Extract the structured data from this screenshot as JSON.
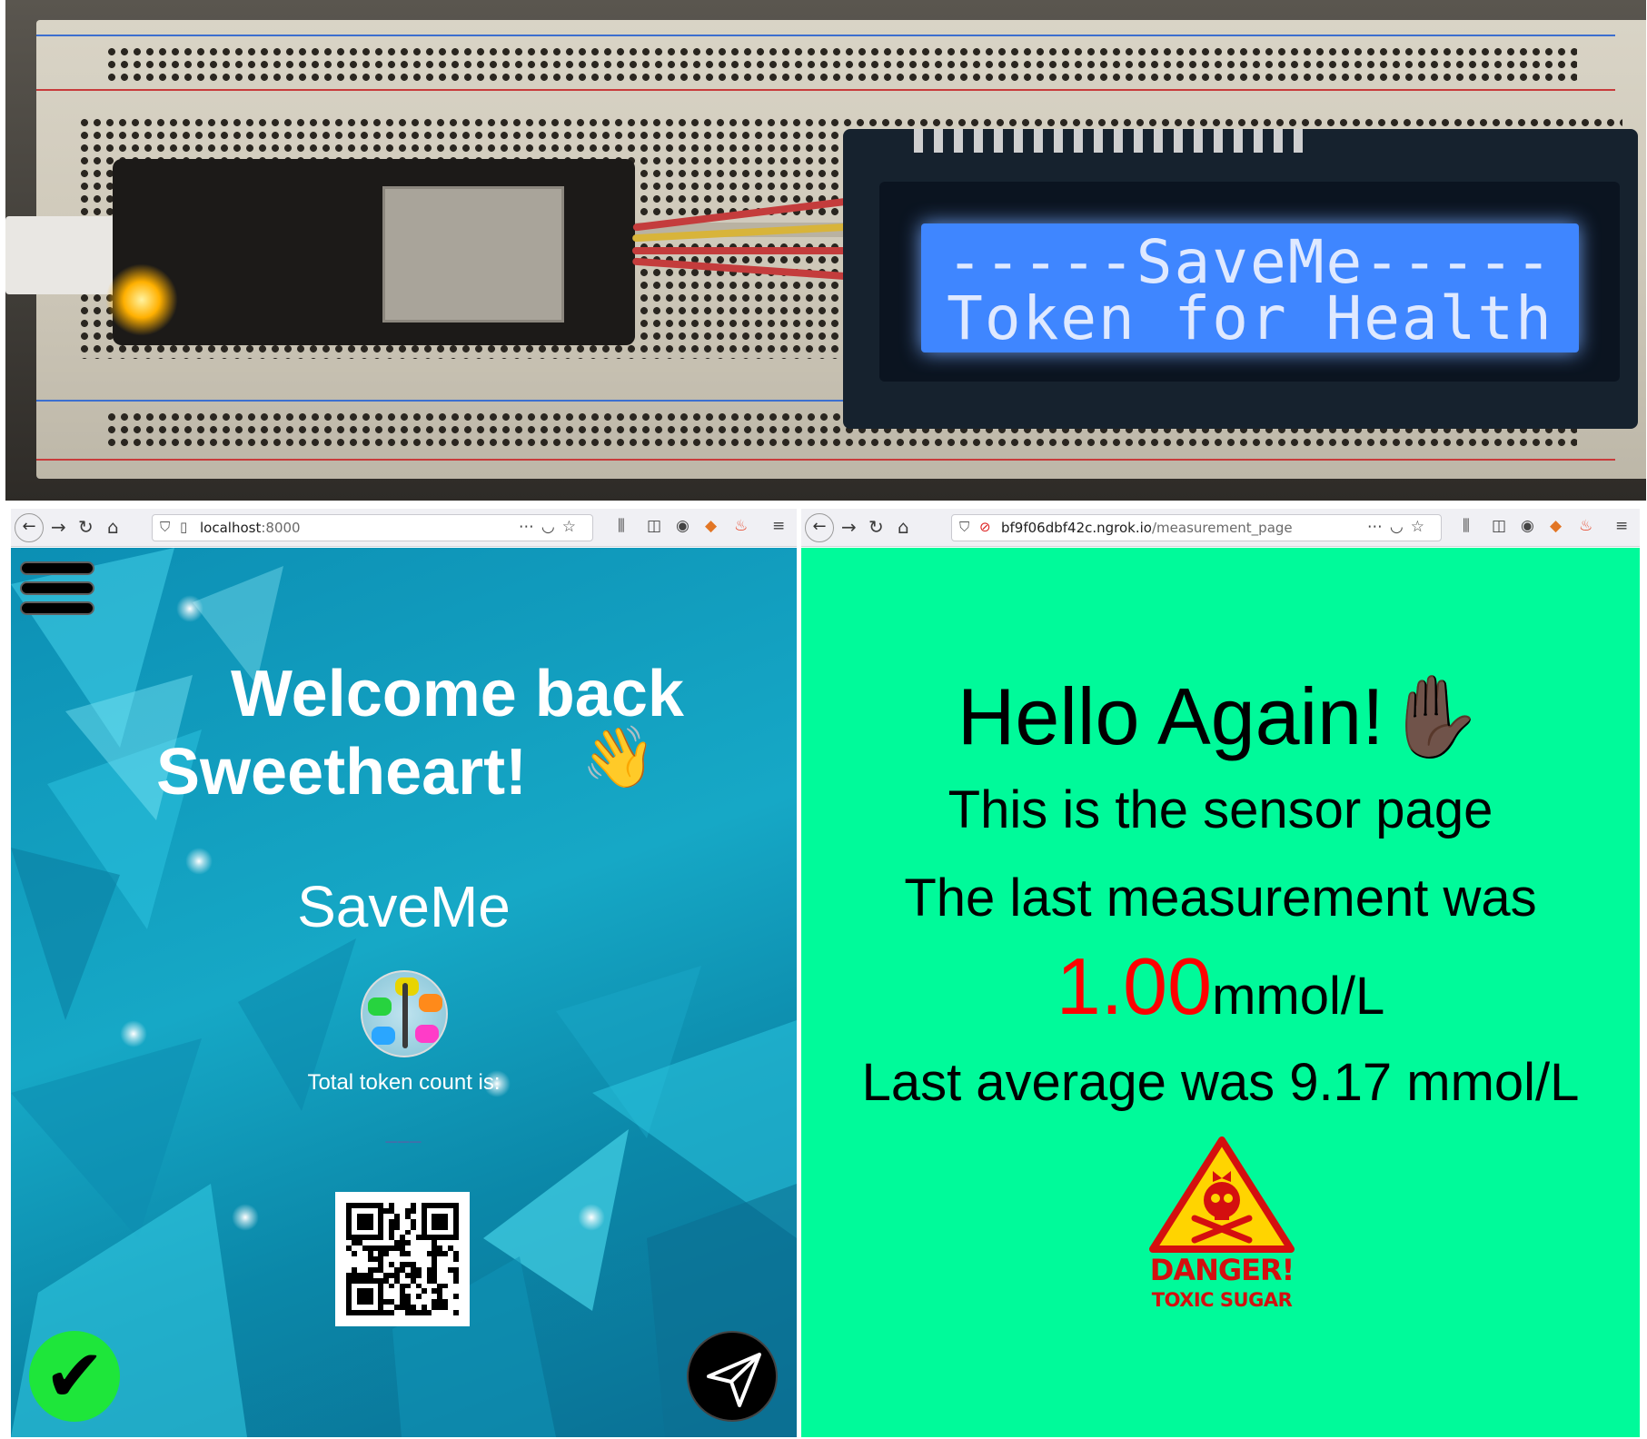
{
  "photo": {
    "lcd_line1": "-----SaveMe-----",
    "lcd_line2": "Token for Health"
  },
  "left_browser": {
    "url_host": "localhost",
    "url_path": ":8000"
  },
  "right_browser": {
    "url_host": "bf9f06dbf42c.ngrok.io",
    "url_path": "/measurement_page"
  },
  "left_page": {
    "welcome_line1": "Welcome back",
    "welcome_line2": "Sweetheart!",
    "wave_emoji": "👋",
    "brand": "SaveMe",
    "token_label": "Total token count is:",
    "token_count": "___",
    "check_icon": "✔",
    "colors": {
      "check_button": "#1ee63a",
      "token_count": "#7a4aa2"
    }
  },
  "right_page": {
    "hello": "Hello Again!",
    "wave_emoji": "✋🏿",
    "sensor_text": "This is the sensor page",
    "last_measurement_text": "The last measurement was",
    "last_value": "1.00",
    "last_unit": "mmol/L",
    "average_text": "Last average was 9.17 mmol/L",
    "danger_line1": "DANGER!",
    "danger_line2": "TOXIC SUGAR",
    "colors": {
      "background": "#00fa9a",
      "value": "#ff0000",
      "danger": "#d40f0f"
    }
  }
}
